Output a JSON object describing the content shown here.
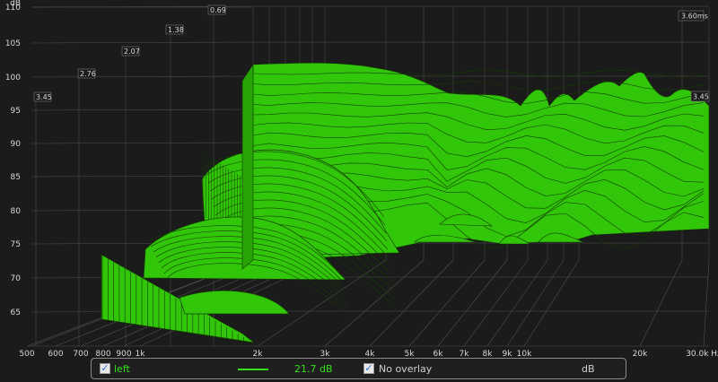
{
  "y_axis": {
    "unit": "dB",
    "ticks": [
      "110",
      "105",
      "100",
      "95",
      "90",
      "85",
      "80",
      "75",
      "70",
      "65"
    ]
  },
  "x_axis": {
    "unit": "Hz",
    "ticks": [
      "500",
      "600",
      "700",
      "800",
      "900",
      "1k",
      "2k",
      "3k",
      "4k",
      "5k",
      "6k",
      "7k",
      "8k",
      "9k",
      "10k",
      "20k",
      "30.0k Hz"
    ]
  },
  "time_axis": {
    "labels": [
      "3.45",
      "2.76",
      "2.07",
      "1.38",
      "0.69"
    ],
    "end_label": "3.60ms",
    "right_label": "3.45"
  },
  "legend": {
    "series_label": "left",
    "series_checked": "✓",
    "series_color": "#35e01a",
    "value": "21.7 dB",
    "overlay_checked": "✓",
    "overlay_label": "No overlay",
    "unit_label": "dB"
  },
  "colors": {
    "fill": "#32c60b",
    "fill_dark": "#27a305",
    "grid": "#505050",
    "background": "#1b1b1b"
  }
}
